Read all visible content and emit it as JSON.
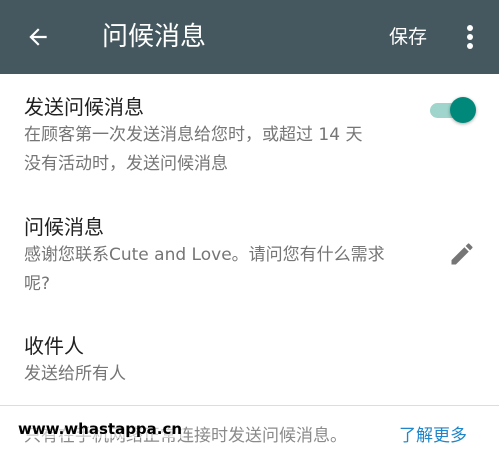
{
  "appbar": {
    "back_icon": "arrow-left-icon",
    "title": "问候消息",
    "save_label": "保存",
    "more_icon": "more-vert-icon"
  },
  "send_greeting": {
    "title": "发送问候消息",
    "description_line1": "在顾客第一次发送消息给您时，或超过 14 天",
    "description_line2": "没有活动时，发送问候消息",
    "enabled": true
  },
  "greeting_message": {
    "title": "问候消息",
    "message_line1": "感谢您联系Cute and Love。请问您有什么需求",
    "message_line2": "呢?",
    "edit_icon": "pencil-icon"
  },
  "recipients": {
    "title": "收件人",
    "value": "发送给所有人"
  },
  "footer": {
    "note": "只有在手机网络正常连接时发送问候消息。",
    "learn_more": "了解更多"
  },
  "watermark": "www.whastappa.cn",
  "colors": {
    "appbar_bg": "#45585f",
    "accent": "#00897b",
    "link": "#1f86c9"
  }
}
